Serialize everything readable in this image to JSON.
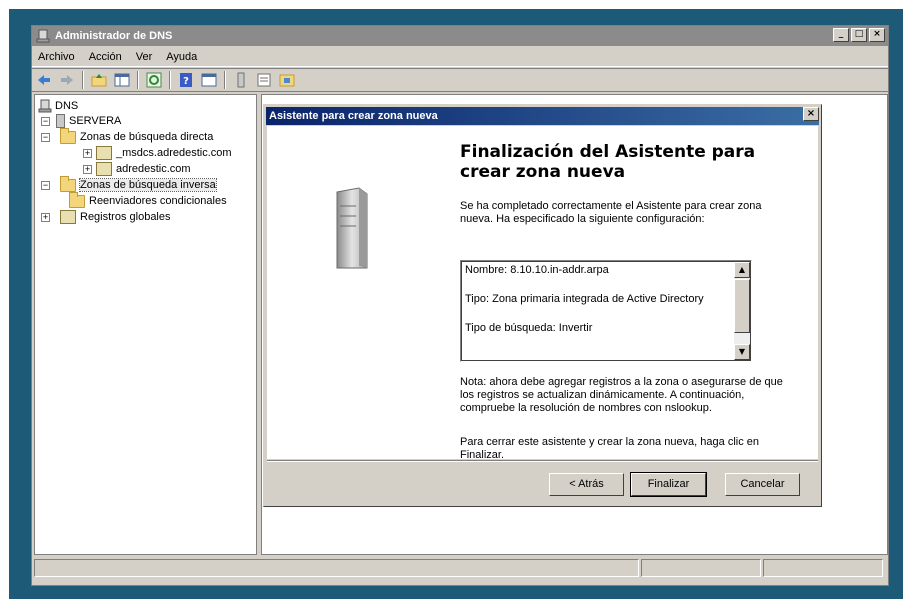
{
  "window": {
    "title": "Administrador de DNS",
    "controls": [
      "_",
      "□",
      "×"
    ]
  },
  "menubar": [
    "Archivo",
    "Acción",
    "Ver",
    "Ayuda"
  ],
  "tree": {
    "root": "DNS",
    "server": "SERVERA",
    "items": [
      {
        "label": "Zonas de búsqueda directa",
        "expander": "−"
      },
      {
        "label": "_msdcs.adredestic.com",
        "expander": "+"
      },
      {
        "label": "adredestic.com",
        "expander": "+"
      },
      {
        "label": "Zonas de búsqueda inversa",
        "expander": "−"
      },
      {
        "label": "Reenviadores condicionales",
        "expander": ""
      },
      {
        "label": "Registros globales",
        "expander": "+"
      }
    ],
    "server_expander": "−"
  },
  "dialog": {
    "title": "Asistente para crear zona nueva",
    "close": "×",
    "heading": "Finalización del Asistente para crear zona nueva",
    "intro": "Se ha completado correctamente el Asistente para crear zona nueva. Ha especificado la siguiente configuración:",
    "summary": {
      "nombre": "Nombre:  8.10.10.in-addr.arpa",
      "tipo": "Tipo:     Zona primaria integrada de Active Directory",
      "busqueda": "Tipo de búsqueda:  Invertir"
    },
    "nota": "Nota: ahora debe agregar registros a la zona o asegurarse de que los registros se actualizan dinámicamente. A continuación, compruebe la resolución de nombres con nslookup.",
    "cerrar": "Para cerrar este asistente y crear la zona nueva, haga clic en Finalizar.",
    "buttons": {
      "back": "< Atrás",
      "finish": "Finalizar",
      "cancel": "Cancelar"
    }
  },
  "colors": {
    "titlebar_active": "#0a246a",
    "titlebar_inactive": "#8b8b8b",
    "desktop": "#1d5a78",
    "face": "#d4d0c8"
  }
}
